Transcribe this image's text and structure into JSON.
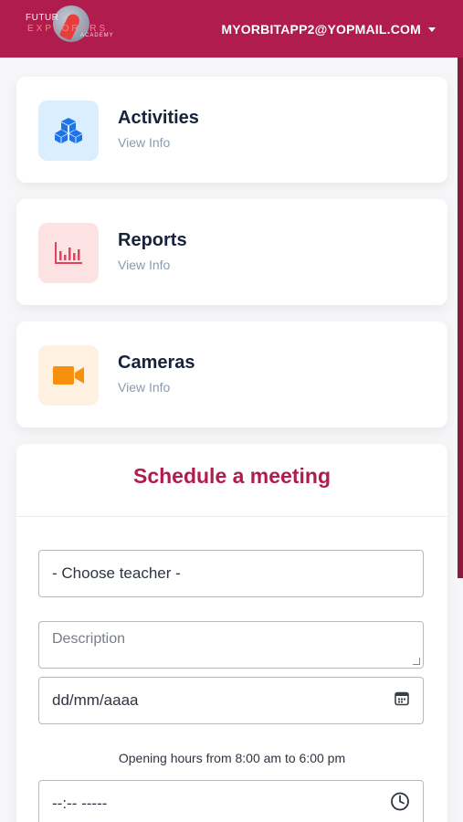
{
  "header": {
    "logo_line1": "FUTUR",
    "logo_line2": "EXPLORERS",
    "logo_line3": "ACADEMY",
    "user_email": "MYORBITAPP2@YOPMAIL.COM",
    "accent_color": "#b01c4d"
  },
  "cards": [
    {
      "title": "Activities",
      "subtitle": "View Info",
      "icon": "cubes-icon",
      "icon_bg": "#dbeefd",
      "icon_color": "#1f73e8"
    },
    {
      "title": "Reports",
      "subtitle": "View Info",
      "icon": "bar-chart-icon",
      "icon_bg": "#fde2e4",
      "icon_color": "#e0435b"
    },
    {
      "title": "Cameras",
      "subtitle": "View Info",
      "icon": "video-camera-icon",
      "icon_bg": "#fff1e1",
      "icon_color": "#f7900f"
    }
  ],
  "schedule": {
    "title": "Schedule a meeting",
    "teacher_select": "- Choose teacher -",
    "description_placeholder": "Description",
    "date_placeholder": "dd/mm/aaaa",
    "hours_note": "Opening hours from 8:00 am to 6:00 pm",
    "time_placeholder": "--:-- -----"
  }
}
